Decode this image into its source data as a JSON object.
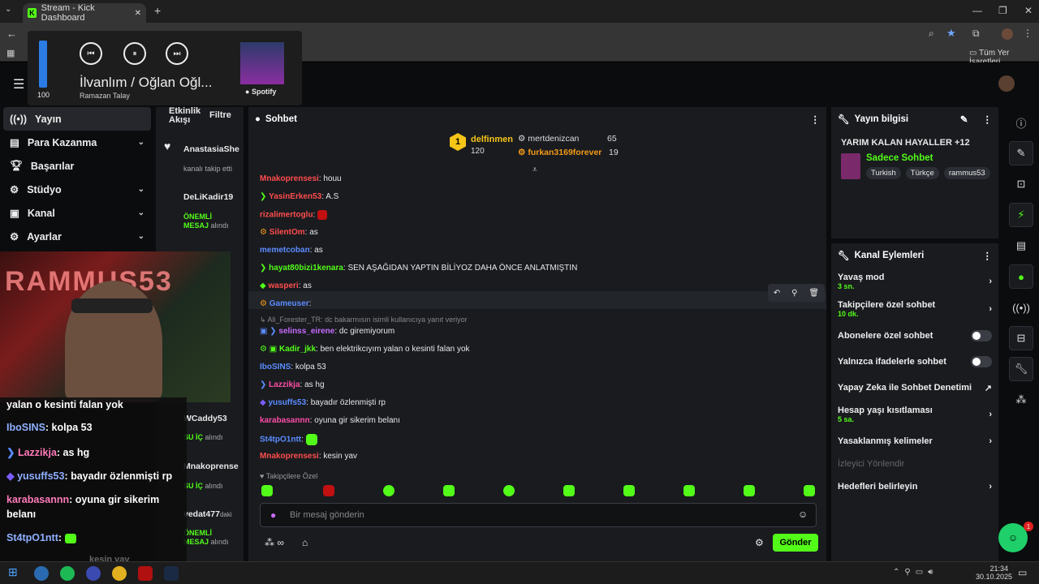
{
  "browser": {
    "tab_title": "Stream - Kick Dashboard",
    "bookmarks_label": "Tüm Yer İşaretleri"
  },
  "media": {
    "volume": "100",
    "track": "İlvanlım / Oğlan Oğl...",
    "artist": "Ramazan Talay",
    "source": "Spotify"
  },
  "nav": {
    "items": [
      {
        "label": "Yayın",
        "chev": ""
      },
      {
        "label": "Para Kazanma",
        "chev": "⌄"
      },
      {
        "label": "Başarılar",
        "chev": ""
      },
      {
        "label": "Stüdyo",
        "chev": "⌄"
      },
      {
        "label": "Kanal",
        "chev": "⌄"
      },
      {
        "label": "Ayarlar",
        "chev": "⌄"
      }
    ]
  },
  "activity": {
    "title_line1": "Etkinlik",
    "title_line2": "Akışı",
    "filter": "Filtre",
    "events": [
      {
        "user": "AnastasiaShe",
        "desc": "kanalı takip etti"
      },
      {
        "user": "DeLiKadir19",
        "desc_a": "ÖNEMLİ",
        "desc_b": "MESAJ",
        "desc_c": "alındı"
      },
      {
        "user": "WCaddy53",
        "desc_a": "SU İÇ",
        "desc_c": "alındı"
      },
      {
        "user": "Mnakoprense",
        "desc_a": "SU İÇ",
        "desc_c": "alındı"
      },
      {
        "user": "vedat477",
        "desc_d": "daki",
        "desc_a": "ÖNEMLİ",
        "desc_b": "MESAJ",
        "desc_c": "alındı"
      }
    ]
  },
  "chat": {
    "title": "Sohbet",
    "leaders": {
      "first": {
        "rank": "1",
        "name": "delfinmen",
        "count": "120"
      },
      "second": {
        "name": "mertdenizcan",
        "count": "65"
      },
      "third": {
        "name": "furkan3169forever",
        "count": "19"
      }
    },
    "messages": [
      {
        "user": "Mnakoprensesi",
        "text": ": houu",
        "color": "#ff4d4d"
      },
      {
        "user": "YasinErken53",
        "text": ": A.S",
        "color": "#ff4d4d"
      },
      {
        "user": "rizalimertoglu",
        "text": ":",
        "color": "#ff4d4d"
      },
      {
        "user": "SilentOm",
        "text": ": as",
        "color": "#ff4d4d"
      },
      {
        "user": "memetcoban",
        "text": ": as",
        "color": "#5b8cff"
      },
      {
        "user": "hayat80bizi1kenara",
        "text": ": SEN AŞAĞIDAN YAPTIN BİLİYOZ DAHA ÖNCE ANLATMIŞTIN",
        "color": "#53fc18"
      },
      {
        "user": "wasperi",
        "text": ": as",
        "color": "#ff4d4d"
      },
      {
        "user": "Gameuser",
        "text": ":",
        "color": "#5b8cff"
      },
      {
        "user": "selinss_eirene",
        "text": ": dc giremiyorum",
        "color": "#c86bff"
      },
      {
        "user": "Kadir_jkk",
        "text": ": ben elektrikcıyım yalan o kesinti falan yok",
        "color": "#53fc18"
      },
      {
        "user": "IboSINS",
        "text": ": kolpa 53",
        "color": "#5b8cff"
      },
      {
        "user": "Lazzikja",
        "text": ": as hg",
        "color": "#ff4da6"
      },
      {
        "user": "yusuffs53",
        "text": ": bayadır özlenmişti rp",
        "color": "#5b8cff"
      },
      {
        "user": "karabasannn",
        "text": ": oyuna gir sikerim belanı",
        "color": "#ff4da6"
      },
      {
        "user": "St4tpO1ntt",
        "text": ":",
        "color": "#5b8cff"
      },
      {
        "user": "Mnakoprensesi",
        "text": ": kesin yav",
        "color": "#ff4d4d"
      }
    ],
    "reply_note": "Ali_Forester_TR: dc bakarmısın isimli kullanıcıya yanıt veriyor",
    "followers_only": "Takipçilere Özel",
    "input_placeholder": "Bir mesaj gönderin",
    "send": "Gönder"
  },
  "info": {
    "title": "Yayın bilgisi",
    "stream_title": "YARIM KALAN HAYALLER +12",
    "category": "Sadece Sohbet",
    "tags": [
      "Turkish",
      "Türkçe",
      "rammus53"
    ]
  },
  "actions": {
    "title": "Kanal Eylemleri",
    "items": [
      {
        "label": "Yavaş mod",
        "sub": "3 sn."
      },
      {
        "label": "Takipçilere özel sohbet",
        "sub": "10 dk."
      },
      {
        "label": "Abonelere özel sohbet"
      },
      {
        "label": "Yalnızca ifadelerle sohbet"
      },
      {
        "label": "Yapay Zeka ile Sohbet Denetimi"
      },
      {
        "label": "Hesap yaşı kısıtlaması",
        "sub": "5 sa."
      },
      {
        "label": "Yasaklanmış kelimeler"
      },
      {
        "label": "İzleyici Yönlendir"
      },
      {
        "label": "Hedefleri belirleyin"
      }
    ]
  },
  "overlay_chat": {
    "lines": [
      {
        "user": "",
        "text": "yalan o kesinti falan yok",
        "color": "#ffffff"
      },
      {
        "user": "IboSINS",
        "text": ": kolpa 53",
        "color": "#8fb0ff"
      },
      {
        "user": "Lazzikja",
        "text": ": as hg",
        "color": "#ff7ab8"
      },
      {
        "user": "yusuffs53",
        "text": ": bayadır özlenmişti rp",
        "color": "#8fb0ff"
      },
      {
        "user": "karabasannn",
        "text": ": oyuna gir sikerim",
        "color": "#ff7ab8"
      },
      {
        "user": "",
        "text": "belanı",
        "color": "#ffffff"
      },
      {
        "user": "St4tpO1ntt",
        "text": ":",
        "color": "#8fb0ff"
      },
      {
        "user": "",
        "text": "kesin yav",
        "color": "#888"
      }
    ]
  },
  "webcam_text": "RAMMUS53",
  "notification_count": "1",
  "clock": {
    "time": "21:34",
    "date": "30.10.2025"
  }
}
